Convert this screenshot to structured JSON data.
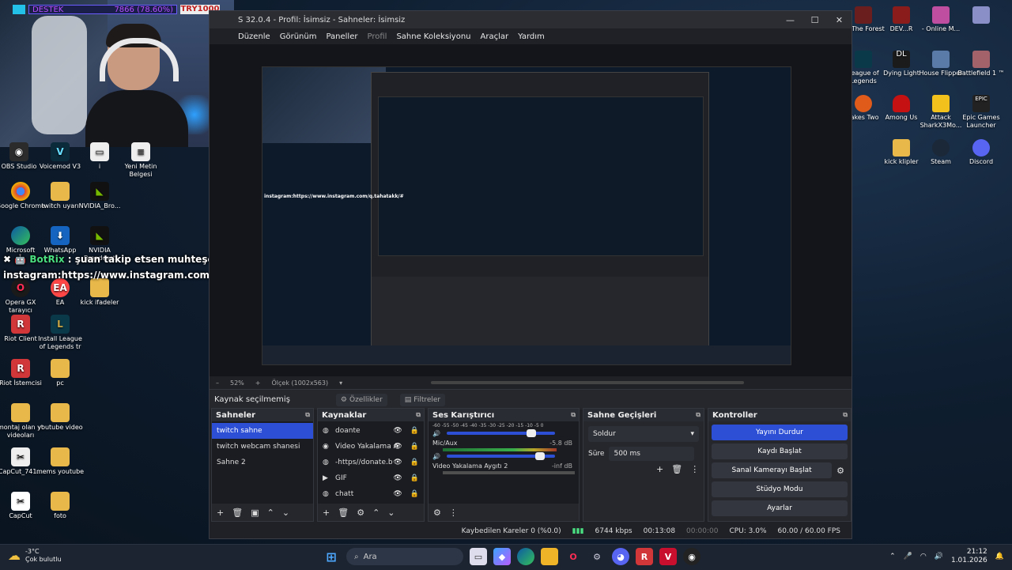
{
  "webcam": {
    "bar_label": "DESTEK",
    "bar_value": "7866 (78.60%)",
    "tag": "TRY1000"
  },
  "desktop_left": [
    {
      "label": "OBS Studio",
      "icon": "obs-icon"
    },
    {
      "label": "Voicemod V3",
      "icon": "voicemod-icon"
    },
    {
      "label": "i",
      "icon": "file-icon"
    },
    {
      "label": "Yeni Metin Belgesi",
      "icon": "text-doc-icon"
    },
    {
      "label": "Google Chrome",
      "icon": "chrome-icon"
    },
    {
      "label": "twitch uyarı",
      "icon": "folder-icon"
    },
    {
      "label": "NVIDIA_Bro...",
      "icon": "nvidia-icon"
    },
    {
      "label": "Microsoft",
      "icon": "edge-icon"
    },
    {
      "label": "WhatsApp",
      "icon": "whatsapp-icon"
    },
    {
      "label": "NVIDIA Broadcast",
      "icon": "nvidia-icon"
    },
    {
      "label": "Opera GX tarayıcı",
      "icon": "opera-icon"
    },
    {
      "label": "EA",
      "icon": "ea-icon"
    },
    {
      "label": "kick ifadeler",
      "icon": "folder-icon"
    },
    {
      "label": "Riot Client",
      "icon": "riot-icon"
    },
    {
      "label": "Install League of Legends tr",
      "icon": "league-icon"
    },
    {
      "label": "Riot İstemcisi",
      "icon": "riot-icon"
    },
    {
      "label": "pc",
      "icon": "folder-icon"
    },
    {
      "label": "montaj olan yt videoları",
      "icon": "folder-icon"
    },
    {
      "label": "youtube video",
      "icon": "folder-icon"
    },
    {
      "label": "CapCut_741...",
      "icon": "capcut-icon"
    },
    {
      "label": "mems youtube",
      "icon": "folder-icon"
    },
    {
      "label": "CapCut",
      "icon": "capcut-icon"
    },
    {
      "label": "foto",
      "icon": "folder-icon"
    }
  ],
  "desktop_right": [
    {
      "label": "Of The Forest"
    },
    {
      "label": "DEV...R"
    },
    {
      "label": "- Online M..."
    },
    {
      "label": "League of Legends"
    },
    {
      "label": "Dying Light"
    },
    {
      "label": "House Flipper"
    },
    {
      "label": "Battlefield 1 ™"
    },
    {
      "label": "takes Two"
    },
    {
      "label": "Among Us"
    },
    {
      "label": "Attack SharkX3Mo..."
    },
    {
      "label": "Epic Games Launcher"
    },
    {
      "label": "kick klipler"
    },
    {
      "label": "Steam"
    },
    {
      "label": "Discord"
    }
  ],
  "chat": {
    "line1_prefix": "✖ 🤖",
    "bot_name": "BotRix",
    "line1_text": ": şuan takip etsen muhteşem olur...",
    "line2_text": "instagram:https://www.instagram.com/q.tahatakk/#"
  },
  "obs": {
    "title": "S 32.0.4 - Profil: İsimsiz - Sahneler: İsimsiz",
    "menu": [
      "Düzenle",
      "Görünüm",
      "Paneller",
      "Profil",
      "Sahne Koleksiyonu",
      "Araçlar",
      "Yardım"
    ],
    "zoom": "52%",
    "scale": "Ölçek (1002x563)",
    "no_source": "Kaynak seçilmemiş",
    "properties": "Özellikler",
    "filters": "Filtreler",
    "scenes_title": "Sahneler",
    "scenes": [
      "twitch sahne",
      "twitch webcam shanesi",
      "Sahne 2"
    ],
    "sources_title": "Kaynaklar",
    "sources": [
      {
        "name": "doante",
        "icon": "browser-icon"
      },
      {
        "name": "Video Yakalama A",
        "icon": "camera-icon"
      },
      {
        "name": "-https//donate.b",
        "icon": "browser-icon"
      },
      {
        "name": "GIF",
        "icon": "play-icon"
      },
      {
        "name": "chatt",
        "icon": "browser-icon"
      }
    ],
    "mixer_title": "Ses Karıştırıcı",
    "mixer_scale": "-60 -55 -50 -45 -40 -35 -30 -25 -20 -15 -10 -5 0",
    "mixer_channels": [
      {
        "name": "",
        "db": "",
        "level": 0.78
      },
      {
        "name": "Mic/Aux",
        "db": "-5.8 dB",
        "level": 0.86
      },
      {
        "name": "Video Yakalama Aygıtı 2",
        "db": "-inf dB",
        "level": 0.0
      }
    ],
    "transitions_title": "Sahne Geçişleri",
    "transition": "Soldur",
    "duration_label": "Süre",
    "duration": "500 ms",
    "controls_title": "Kontroller",
    "controls": [
      "Yayını Durdur",
      "Kaydı Başlat",
      "Sanal Kamerayı Başlat",
      "Stüdyo Modu",
      "Ayarlar"
    ],
    "status": {
      "dropped": "Kaybedilen Kareler 0 (%0.0)",
      "bitrate": "6744 kbps",
      "stream_time": "00:13:08",
      "rec_time": "00:00:00",
      "cpu": "CPU: 3.0%",
      "fps": "60.00 / 60.00 FPS"
    },
    "accent": "#2c4fd6"
  },
  "taskbar": {
    "temp": "-3°C",
    "weather": "Çok bulutlu",
    "search": "Ara",
    "time": "21:12",
    "date": "1.01.2026"
  }
}
